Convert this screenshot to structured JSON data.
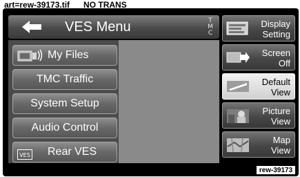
{
  "caption": "art=rew-39173.tif      NO TRANS",
  "header": {
    "title": "VES Menu",
    "tmc_indicator": [
      "T",
      "M",
      "C"
    ]
  },
  "menu": [
    {
      "label": "My Files",
      "icon": "music-files-icon"
    },
    {
      "label": "TMC Traffic"
    },
    {
      "label": "System Setup"
    },
    {
      "label": "Audio Control"
    },
    {
      "label": "Rear VES",
      "icon": "ves-icon",
      "icon_text": "VES"
    }
  ],
  "side_buttons": [
    {
      "line1": "Display",
      "line2": "Setting",
      "icon": "display-setting-icon"
    },
    {
      "line1": "Screen",
      "line2": "Off",
      "icon": "screen-off-icon"
    },
    {
      "line1": "Default",
      "line2": "View",
      "icon": "default-view-icon",
      "active": true
    },
    {
      "line1": "Picture",
      "line2": "View",
      "icon": "picture-view-icon"
    },
    {
      "line1": "Map",
      "line2": "View",
      "icon": "map-view-icon"
    }
  ],
  "reference": "rew-39173",
  "colors": {
    "bezel": "#000000",
    "menu_button": "#686868",
    "active_button": "#e0e0e0",
    "content_panel": "#8a8a8a"
  }
}
